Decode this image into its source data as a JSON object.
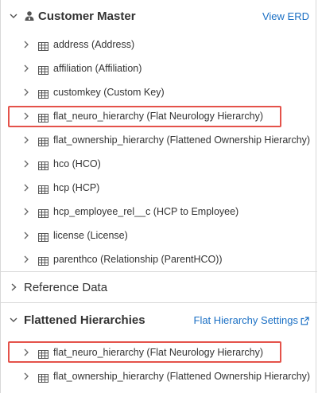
{
  "sections": {
    "customer_master": {
      "title": "Customer Master",
      "link": "View ERD",
      "items": [
        {
          "label": "address (Address)"
        },
        {
          "label": "affiliation (Affiliation)"
        },
        {
          "label": "customkey (Custom Key)"
        },
        {
          "label": "flat_neuro_hierarchy (Flat Neurology Hierarchy)",
          "highlighted": true
        },
        {
          "label": "flat_ownership_hierarchy (Flattened Ownership Hierarchy)"
        },
        {
          "label": "hco (HCO)"
        },
        {
          "label": "hcp (HCP)"
        },
        {
          "label": "hcp_employee_rel__c (HCP to Employee)"
        },
        {
          "label": "license (License)"
        },
        {
          "label": "parenthco (Relationship (ParentHCO))"
        }
      ]
    },
    "reference_data": {
      "title": "Reference Data"
    },
    "flattened_hierarchies": {
      "title": "Flattened Hierarchies",
      "link": "Flat Hierarchy Settings",
      "items": [
        {
          "label": "flat_neuro_hierarchy (Flat Neurology Hierarchy)",
          "highlighted": true
        },
        {
          "label": "flat_ownership_hierarchy (Flattened Ownership Hierarchy)"
        }
      ]
    }
  },
  "colors": {
    "link": "#1a6fc4",
    "highlight": "#e4524a",
    "border": "#d8d8d8"
  }
}
